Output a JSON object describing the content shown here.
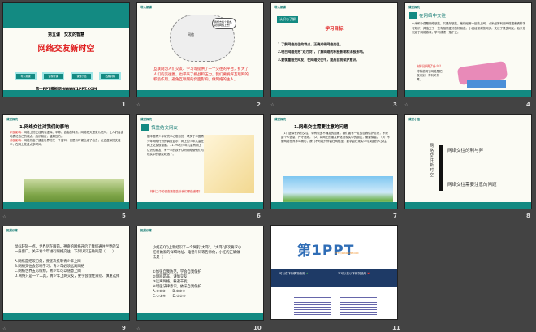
{
  "slides": [
    {
      "n": "1",
      "tag": "",
      "sub": "第五课　交友的智慧",
      "title": "网络交友新时空",
      "buttons": [
        "导入新课",
        "讲授新课",
        "课堂小结",
        "拓展训练"
      ],
      "footer": "第一PPT模板网-WWW.1PPT.COM"
    },
    {
      "n": "2",
      "tag": "导入新课",
      "bubble": "我想去找个朋友，就到网络上去！",
      "cloud": "网络",
      "text": "互联网为人们交友、学习等提供了一个交往的平台，扩大了人们的交往圈，也带来了挑战和压力。我们要发挥互联网的积极作用，避免互联网的负面影响，做网络的主人。"
    },
    {
      "n": "3",
      "tag": "导入新课",
      "badge": "认识与了解",
      "title": "学习目标",
      "items": [
        "1.了解网络交往的特点，正确对待网络交往。",
        "2.明白网络是把\"双刃剑\"，了解网络的积极影响和消极影响。",
        "3.要慎重结交网友，在网络交往中，提高自我保护意识。"
      ]
    },
    {
      "n": "4",
      "tag": "课堂探究",
      "heading": "在网络中交往",
      "text": "小米和小强是网络朋友，又是好朋友。他们经常一起去上网。小米经常利用网络搜索资料学习知识，并结交了一些有相同爱好的好朋友。小强经常浏览网页，交往了很多网友，后来他沉迷于网络游戏，学习成绩一落千丈。",
      "question": "材料说明了什么？",
      "answer": "材料说明了网络是把双刃剑，有利又有弊。"
    },
    {
      "n": "5",
      "tag": "课堂探究",
      "title": "1.网络交往对我们的影响",
      "pos_label": "积极影响：",
      "pos": "网络上的交往具有虚拟、平等、自由的特点，网络把天涯变为咫尺，让人们自由地表达自己的观点，结识朋友，缓解压力。",
      "neg_label": "消极影响：",
      "neg": "网络开启了通往世界的又一个窗口，但是有时候也走了出去，走进虚拟的交往中，在网上花费太多时间。"
    },
    {
      "n": "6",
      "tag": "课堂探究",
      "heading": "慎重结交网友",
      "text": "据中国青少年研究中心发布的一项关于中国青少年网络行为的调查显示，网上的少年儿童在网上交友很普遍。71.2%的少年儿童有网上认识的朋友，有一半的孩子认为网络使他们与现实中的朋友疏远了。",
      "question": "材料二中的调查数据告诉我们哪些道理？"
    },
    {
      "n": "7",
      "tag": "课堂探究",
      "title": "1.网络交往需要注意的问题",
      "text": "（1）虚拟世界的交往，带有很多不确定的因素，我们要有一定的自我保护意识，不泄露个人信息，严守底线。（2）将网上的朋友转化为现实中的朋友，需要慎重。（3）不管网络世界多么精彩，我们不可能只停留在网络里，要学会在现实中与周围的人交往。"
    },
    {
      "n": "8",
      "tag": "课堂小结",
      "vertical": "网络交往新时空",
      "branches": [
        "网络交往的利与弊",
        "网络交往需要注意的问题"
      ]
    },
    {
      "n": "9",
      "tag": "拓展训练",
      "text": "鼠标轻轻一点，世界尽在眼前。神奇的网络开启了我们通往世界的又一扇窗口。关于青少年进行网络交往，下列认识正确的是（　　）",
      "options": [
        "A.网络是把双刃剑，要坚决抵制青少年上网",
        "B.网络交往会影响学习，青少年必须远离网络",
        "C.网络世界五彩缤纷，青少年可以随意上网",
        "D.网络只是一个工具，青少年上网交友，要学会理性辨别、慎重选择"
      ]
    },
    {
      "n": "10",
      "tag": "拓展训练",
      "text": "小红在QQ上新结识了一个网友\"大哥\"，\"大哥\"多次要求小红将她家的详细地址、电话号码等告诉他，小红的正确做法是（　　）",
      "options": [
        "①加强自我防范，学会自我保护",
        "②明辨是非，谨慎交友",
        "③远离网络，躲避干扰",
        "④增强法律意识，依法自我保护",
        "A.①②③　　B.②③④",
        "C.①③④　　D.①②④"
      ]
    },
    {
      "n": "11",
      "logo": "第1PPT",
      "url": "HTTP://WWW.1PPT.COM",
      "can": "可以在下列情况使用",
      "cannot": "不可以在以下情况使用"
    }
  ],
  "colors": {
    "teal": "#138a82",
    "red": "#e02020",
    "bg": "#434343"
  }
}
